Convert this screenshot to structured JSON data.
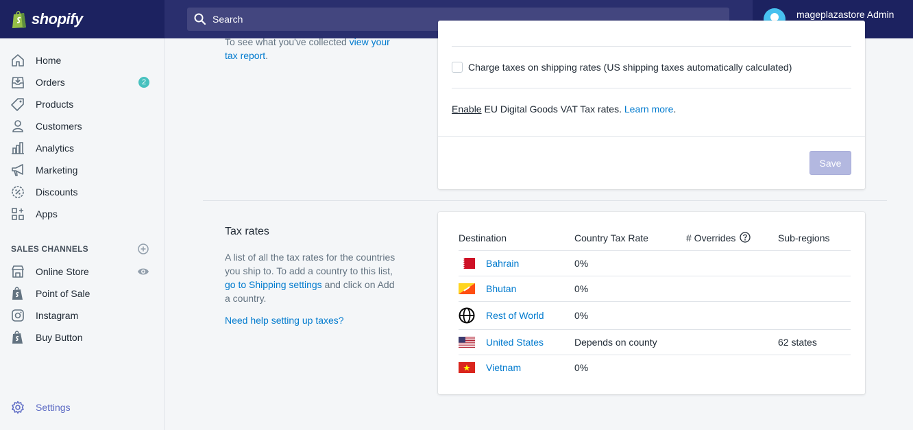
{
  "header": {
    "brand": "shopify",
    "search_placeholder": "Search",
    "user_name": "mageplazastore Admin",
    "user_store": "mageplazastore"
  },
  "sidebar": {
    "items": [
      {
        "label": "Home",
        "icon": "home-icon"
      },
      {
        "label": "Orders",
        "icon": "orders-icon",
        "badge": "2"
      },
      {
        "label": "Products",
        "icon": "tag-icon"
      },
      {
        "label": "Customers",
        "icon": "person-icon"
      },
      {
        "label": "Analytics",
        "icon": "bar-chart-icon"
      },
      {
        "label": "Marketing",
        "icon": "megaphone-icon"
      },
      {
        "label": "Discounts",
        "icon": "discount-icon"
      },
      {
        "label": "Apps",
        "icon": "apps-icon"
      }
    ],
    "sales_channels_title": "SALES CHANNELS",
    "channels": [
      {
        "label": "Online Store",
        "icon": "store-icon"
      },
      {
        "label": "Point of Sale",
        "icon": "shopify-bag-icon"
      },
      {
        "label": "Instagram",
        "icon": "instagram-icon"
      },
      {
        "label": "Buy Button",
        "icon": "shopify-bag-icon"
      }
    ],
    "settings_label": "Settings"
  },
  "tax_report": {
    "text_before": "To see what you've collected ",
    "link": "view your tax report",
    "text_after": "."
  },
  "tax_settings": {
    "shipping_checkbox_label": "Charge taxes on shipping rates (US shipping taxes automatically calculated)",
    "eu_enable": "Enable",
    "eu_text": " EU Digital Goods VAT Tax rates. ",
    "eu_learn_more": "Learn more",
    "eu_period": ".",
    "save_label": "Save"
  },
  "tax_rates": {
    "title": "Tax rates",
    "desc_1": "A list of all the tax rates for the countries you ship to. To add a country to this list, ",
    "desc_link": "go to Shipping settings",
    "desc_2": " and click on Add a country.",
    "help_link": "Need help setting up taxes?",
    "columns": [
      "Destination",
      "Country Tax Rate",
      "# Overrides",
      "Sub-regions"
    ],
    "rows": [
      {
        "destination": "Bahrain",
        "rate": "0%",
        "overrides": "",
        "subregions": ""
      },
      {
        "destination": "Bhutan",
        "rate": "0%",
        "overrides": "",
        "subregions": ""
      },
      {
        "destination": "Rest of World",
        "rate": "0%",
        "overrides": "",
        "subregions": ""
      },
      {
        "destination": "United States",
        "rate": "Depends on county",
        "overrides": "",
        "subregions": "62 states"
      },
      {
        "destination": "Vietnam",
        "rate": "0%",
        "overrides": "",
        "subregions": ""
      }
    ]
  },
  "colors": {
    "topbar": "#1c2260",
    "accent": "#5c6ac4",
    "link": "#007ace"
  }
}
